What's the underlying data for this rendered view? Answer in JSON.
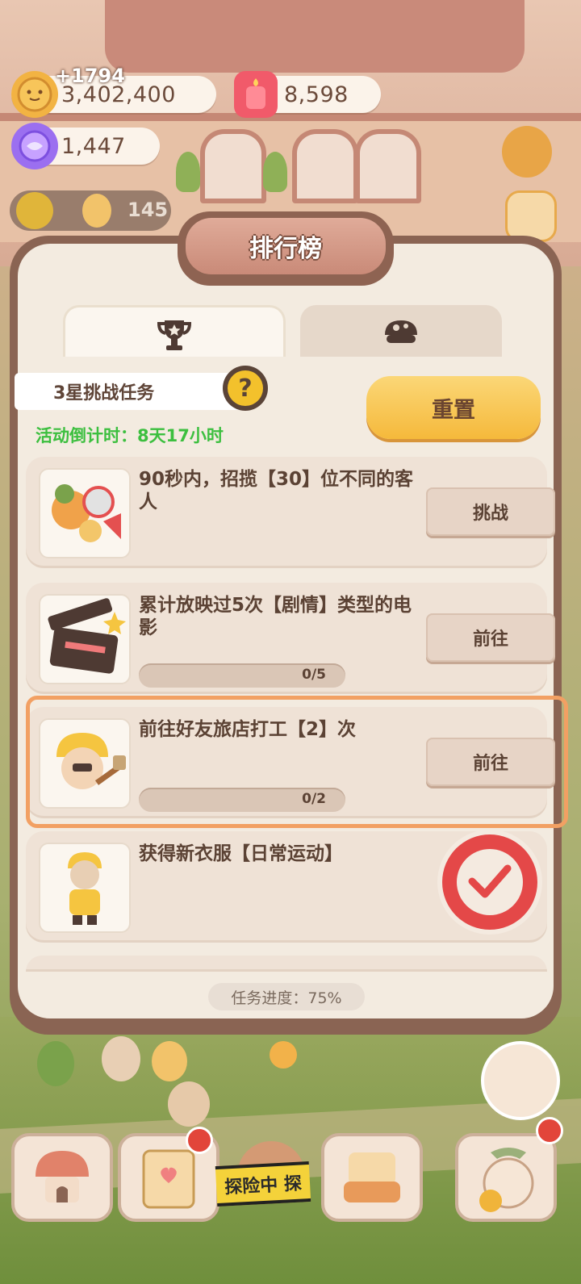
{
  "currency": {
    "coins": "3,402,400",
    "coins_gain": "+1794",
    "candles": "8,598",
    "gems": "1,447",
    "level_count": "145"
  },
  "panel": {
    "title": "排行榜",
    "challenge_label": "3星挑战任务",
    "help": "?",
    "reset_button": "重置",
    "countdown": "活动倒计时：8天17小时",
    "progress": "任务进度：75%"
  },
  "tasks": [
    {
      "text": "90秒内，招揽【30】位不同的客人",
      "button": "挑战"
    },
    {
      "text": "累计放映过5次【剧情】类型的电影",
      "button": "前往",
      "progress_label": "0/5",
      "progress_fraction": 0
    },
    {
      "text": "前往好友旅店打工【2】次",
      "button": "前往",
      "progress_label": "0/2",
      "progress_fraction": 0
    },
    {
      "text": "获得新衣服【日常运动】",
      "completed": true
    }
  ],
  "bottom_nav": {
    "explore_banner": "探险中 探"
  },
  "colors": {
    "countdown_green": "#3cbf3f",
    "reset_yellow": "#f5b93b",
    "panel_frame": "#8a6453",
    "stamp_red": "#e44848",
    "highlight_orange": "#f2a063"
  }
}
